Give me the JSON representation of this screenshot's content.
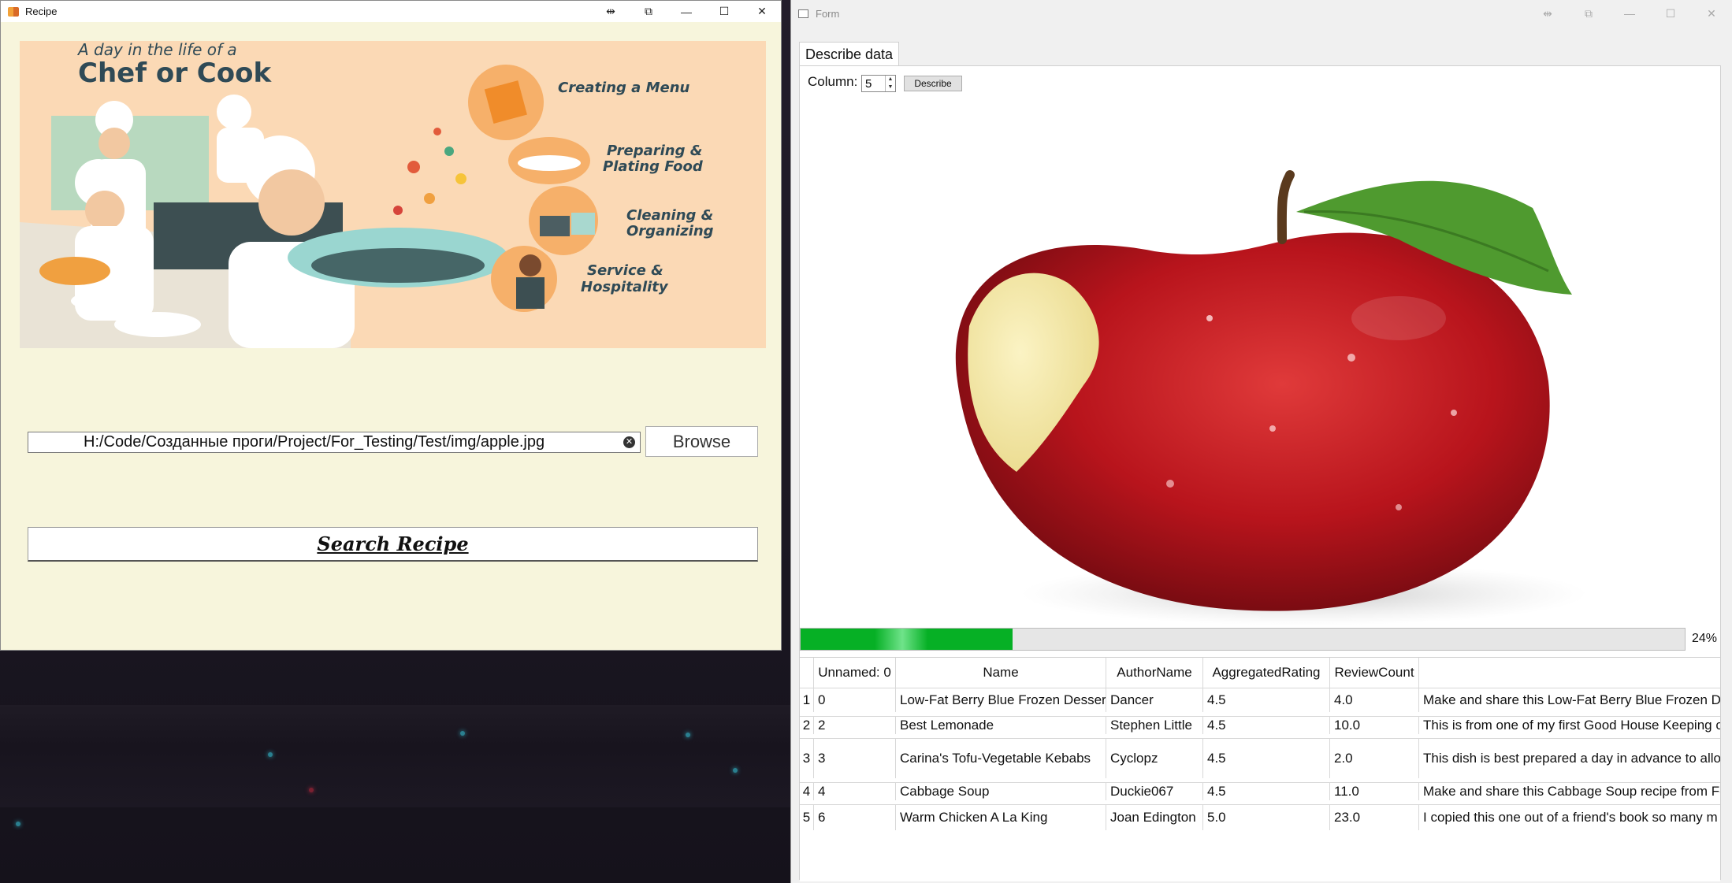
{
  "recipe_window": {
    "title": "Recipe",
    "banner": {
      "small_title": "A day in the life of a",
      "big_title": "Chef or Cook",
      "items": [
        "Creating a Menu",
        "Preparing &",
        "Plating Food",
        "Cleaning &",
        "Organizing",
        "Service &",
        "Hospitality"
      ]
    },
    "path_value": "H:/Code/Созданные проги/Project/For_Testing/Test/img/apple.jpg",
    "browse_label": "Browse",
    "search_label": "Search Recipe"
  },
  "form_window": {
    "title": "Form",
    "tab_label": "Describe data",
    "column_label": "Column:",
    "column_value": "5",
    "describe_label": "Describe",
    "progress_percent": 24,
    "progress_text": "24%",
    "table": {
      "headers": [
        "Unnamed: 0",
        "Name",
        "AuthorName",
        "AggregatedRating",
        "ReviewCount",
        ""
      ],
      "rows": [
        {
          "n": "1",
          "cells": [
            "0",
            "Low-Fat Berry Blue Frozen Dessert",
            "Dancer",
            "4.5",
            "4.0",
            "Make and share this Low-Fat Berry Blue Frozen Des"
          ]
        },
        {
          "n": "2",
          "cells": [
            "2",
            "Best Lemonade",
            "Stephen Little",
            "4.5",
            "10.0",
            "This is from one of my  first Good House Keeping c"
          ]
        },
        {
          "n": "3",
          "cells": [
            "3",
            "Carina's Tofu-Vegetable Kebabs",
            "Cyclopz",
            "4.5",
            "2.0",
            "This dish is best prepared a day in advance to allow"
          ]
        },
        {
          "n": "4",
          "cells": [
            "4",
            "Cabbage Soup",
            "Duckie067",
            "4.5",
            "11.0",
            "Make and share this Cabbage Soup recipe from Fo"
          ]
        },
        {
          "n": "5",
          "cells": [
            "6",
            "Warm Chicken A La King",
            "Joan Edington",
            "5.0",
            "23.0",
            "I copied this one out of a friend's book so many m"
          ]
        }
      ]
    }
  }
}
